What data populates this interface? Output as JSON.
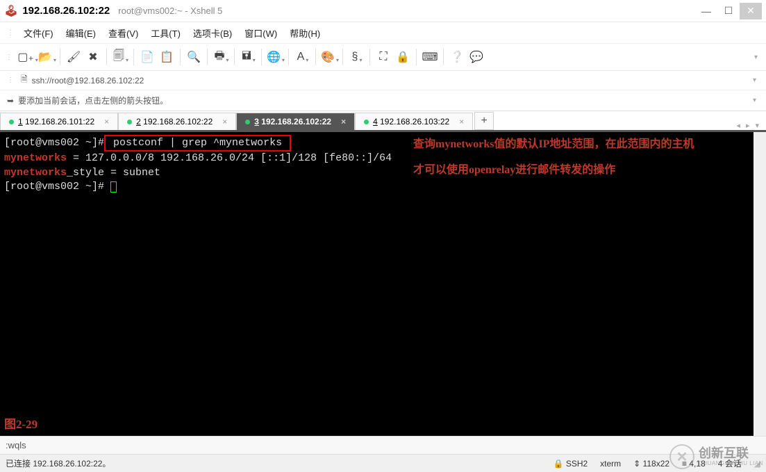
{
  "titlebar": {
    "ip": "192.168.26.102:22",
    "app": "root@vms002:~ - Xshell 5"
  },
  "menu": {
    "items": [
      "文件(F)",
      "编辑(E)",
      "查看(V)",
      "工具(T)",
      "选项卡(B)",
      "窗口(W)",
      "帮助(H)"
    ]
  },
  "toolbar": {
    "icons": [
      {
        "name": "new-session-icon",
        "glyph": "▢₊",
        "dd": true
      },
      {
        "name": "open-icon",
        "glyph": "📂",
        "dd": true
      },
      {
        "name": "sep"
      },
      {
        "name": "reconnect-icon",
        "glyph": "🖌",
        "dd": false
      },
      {
        "name": "disconnect-icon",
        "glyph": "✖",
        "dd": false
      },
      {
        "name": "sep"
      },
      {
        "name": "properties-icon",
        "glyph": "🗐",
        "dd": true
      },
      {
        "name": "sep"
      },
      {
        "name": "copy-icon",
        "glyph": "📄",
        "dd": false
      },
      {
        "name": "paste-icon",
        "glyph": "📋",
        "dd": false
      },
      {
        "name": "sep"
      },
      {
        "name": "find-icon",
        "glyph": "🔍",
        "dd": false
      },
      {
        "name": "sep"
      },
      {
        "name": "print-icon",
        "glyph": "🖶",
        "dd": true
      },
      {
        "name": "sep"
      },
      {
        "name": "transfer-icon",
        "glyph": "🖬",
        "dd": true
      },
      {
        "name": "sep"
      },
      {
        "name": "globe-icon",
        "glyph": "🌐",
        "dd": true
      },
      {
        "name": "sep"
      },
      {
        "name": "font-icon",
        "glyph": "A",
        "dd": true
      },
      {
        "name": "sep"
      },
      {
        "name": "color-icon",
        "glyph": "🎨",
        "dd": true
      },
      {
        "name": "sep"
      },
      {
        "name": "encoding-icon",
        "glyph": "§",
        "dd": true
      },
      {
        "name": "sep"
      },
      {
        "name": "fullscreen-icon",
        "glyph": "⛶",
        "dd": false
      },
      {
        "name": "lock-icon",
        "glyph": "🔒",
        "dd": false
      },
      {
        "name": "sep"
      },
      {
        "name": "keyboard-icon",
        "glyph": "⌨",
        "dd": false
      },
      {
        "name": "sep"
      },
      {
        "name": "help-icon",
        "glyph": "❔",
        "dd": false
      },
      {
        "name": "chat-icon",
        "glyph": "💬",
        "dd": false
      }
    ]
  },
  "addressbar": {
    "protocol_icon": "🗎",
    "url": "ssh://root@192.168.26.102:22"
  },
  "sessionbar": {
    "icon": "➥",
    "hint": "要添加当前会话，点击左侧的箭头按钮。"
  },
  "tabs": {
    "items": [
      {
        "label": "1 192.168.26.101:22",
        "active": false
      },
      {
        "label": "2 192.168.26.102:22",
        "active": false
      },
      {
        "label": "3 192.168.26.102:22",
        "active": true
      },
      {
        "label": "4 192.168.26.103:22",
        "active": false
      }
    ]
  },
  "terminal": {
    "prompt1": "[root@vms002 ~]#",
    "cmd": " postconf | grep ^mynetworks ",
    "out1_k": "mynetworks",
    "out1_r": " = 127.0.0.0/8 192.168.26.0/24 [::1]/128 [fe80::]/64",
    "out2_k": "mynetworks",
    "out2_r": "_style = subnet",
    "prompt2": "[root@vms002 ~]# ",
    "annotation": "查询mynetworks值的默认IP地址范围，在此范围内的主机才可以使用openrelay进行邮件转发的操作",
    "fig": "图2-29"
  },
  "inputbar": {
    "text": ":wqls"
  },
  "statusbar": {
    "left": "已连接 192.168.26.102:22。",
    "proto": "🔒 SSH2",
    "term": "xterm",
    "size": "⇕ 118x22",
    "pos": "≡ 4,18",
    "sessions": "4 会话"
  },
  "watermark": {
    "main": "创新互联",
    "sub": "CHUANG XIN HU LIAN"
  }
}
